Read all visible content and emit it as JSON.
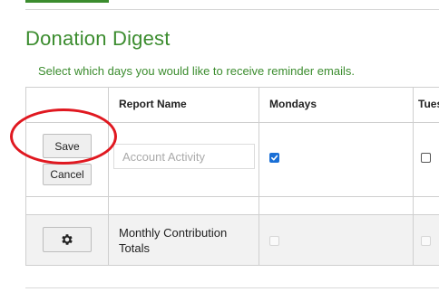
{
  "section": {
    "title": "Donation Digest",
    "subtitle": "Select which days you would like to receive reminder emails."
  },
  "table": {
    "headers": [
      "Report Name",
      "Mondays",
      "Tues"
    ],
    "editing_row": {
      "save_label": "Save",
      "cancel_label": "Cancel",
      "report_name_placeholder": "Account Activity",
      "mondays_checked": true,
      "tuesdays_checked": false
    },
    "rows": [
      {
        "report_name": "Monthly Contribution Totals",
        "mondays_checked": false,
        "tuesdays_checked": false,
        "disabled": true
      }
    ]
  },
  "icons": {
    "settings": "gear-icon",
    "checkbox_checked": "check-icon"
  },
  "colors": {
    "accent_green": "#3b8c2e",
    "annotation_red": "#e01820",
    "checkbox_blue": "#1a6fd6"
  }
}
